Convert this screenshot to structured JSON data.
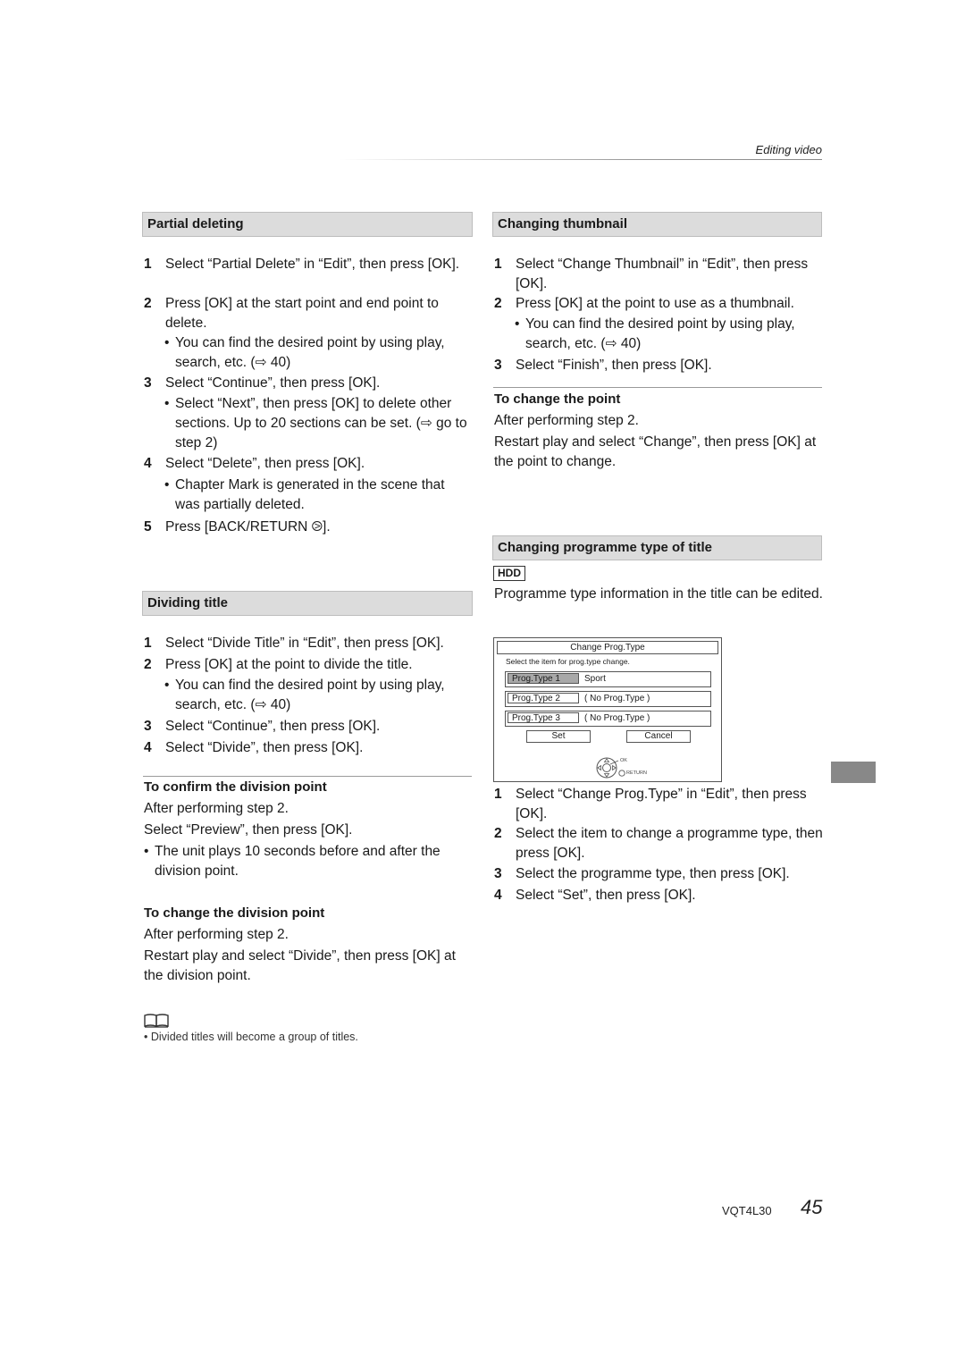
{
  "header": {
    "section_label": "Editing video"
  },
  "left": {
    "partial_deleting": {
      "title": "Partial deleting",
      "steps": [
        {
          "num": "1",
          "text": "Select “Partial Delete” in “Edit”, then press [OK]."
        },
        {
          "num": "2",
          "text": "Press [OK] at the start point and end point to delete."
        },
        {
          "num": "3",
          "text": "Select “Continue”, then press [OK]."
        },
        {
          "num": "4",
          "text": "Select “Delete”, then press [OK]."
        },
        {
          "num": "5",
          "text": "Press [BACK/RETURN ⧁]."
        }
      ],
      "bullets": [
        "You can find the desired point by using play, search, etc. (⇨ 40)",
        "Select “Next”, then press [OK] to delete other sections. Up to 20 sections can be set. (⇨ go to step 2)",
        "Chapter Mark is generated in the scene that was partially deleted."
      ]
    },
    "dividing_title": {
      "title": "Dividing title",
      "steps": [
        {
          "num": "1",
          "text": "Select “Divide Title” in “Edit”, then press [OK]."
        },
        {
          "num": "2",
          "text": "Press [OK] at the point to divide the title."
        },
        {
          "num": "3",
          "text": "Select “Continue”, then press [OK]."
        },
        {
          "num": "4",
          "text": "Select “Divide”, then press [OK]."
        }
      ],
      "bullets": [
        "You can find the desired point by using play, search, etc. (⇨ 40)"
      ]
    },
    "confirm_division": {
      "title": "To confirm the division point",
      "p1": "After performing step 2.",
      "p2": "Select “Preview”, then press [OK].",
      "bullet": "The unit plays 10 seconds before and after the division point."
    },
    "change_division": {
      "title": "To change the division point",
      "p1": "After performing step 2.",
      "p2": "Restart play and select “Divide”, then press [OK] at the division point."
    },
    "note": {
      "icon": "book-icon",
      "text": "Divided titles will become a group of titles."
    }
  },
  "right": {
    "changing_thumbnail": {
      "title": "Changing thumbnail",
      "steps": [
        {
          "num": "1",
          "text": "Select “Change Thumbnail” in “Edit”, then press [OK]."
        },
        {
          "num": "2",
          "text": "Press [OK] at the point to use as a thumbnail."
        },
        {
          "num": "3",
          "text": "Select “Finish”, then press [OK]."
        }
      ],
      "bullets": [
        "You can find the desired point by using play, search, etc. (⇨ 40)"
      ]
    },
    "change_point": {
      "title": "To change the point",
      "p1": "After performing step 2.",
      "p2": "Restart play and select “Change”, then press [OK] at the point to change."
    },
    "changing_prog_type": {
      "title": "Changing programme type of title",
      "badge": "HDD",
      "intro": "Programme type information in the title can be edited.",
      "osd": {
        "title": "Change Prog.Type",
        "subtitle": "Select the item for prog.type change.",
        "rows": [
          {
            "label": "Prog.Type 1",
            "value": "Sport",
            "selected": true
          },
          {
            "label": "Prog.Type 2",
            "value": "( No Prog.Type )",
            "selected": false
          },
          {
            "label": "Prog.Type 3",
            "value": "( No Prog.Type )",
            "selected": false
          }
        ],
        "set_label": "Set",
        "cancel_label": "Cancel",
        "nav_ok": "OK",
        "nav_return": "RETURN"
      },
      "steps": [
        {
          "num": "1",
          "text": "Select “Change Prog.Type” in “Edit”, then press [OK]."
        },
        {
          "num": "2",
          "text": "Select the item to change a programme type, then press [OK]."
        },
        {
          "num": "3",
          "text": "Select the programme type, then press [OK]."
        },
        {
          "num": "4",
          "text": "Select “Set”, then press [OK]."
        }
      ]
    }
  },
  "footer": {
    "model_code": "VQT4L30",
    "page_number": "45"
  }
}
